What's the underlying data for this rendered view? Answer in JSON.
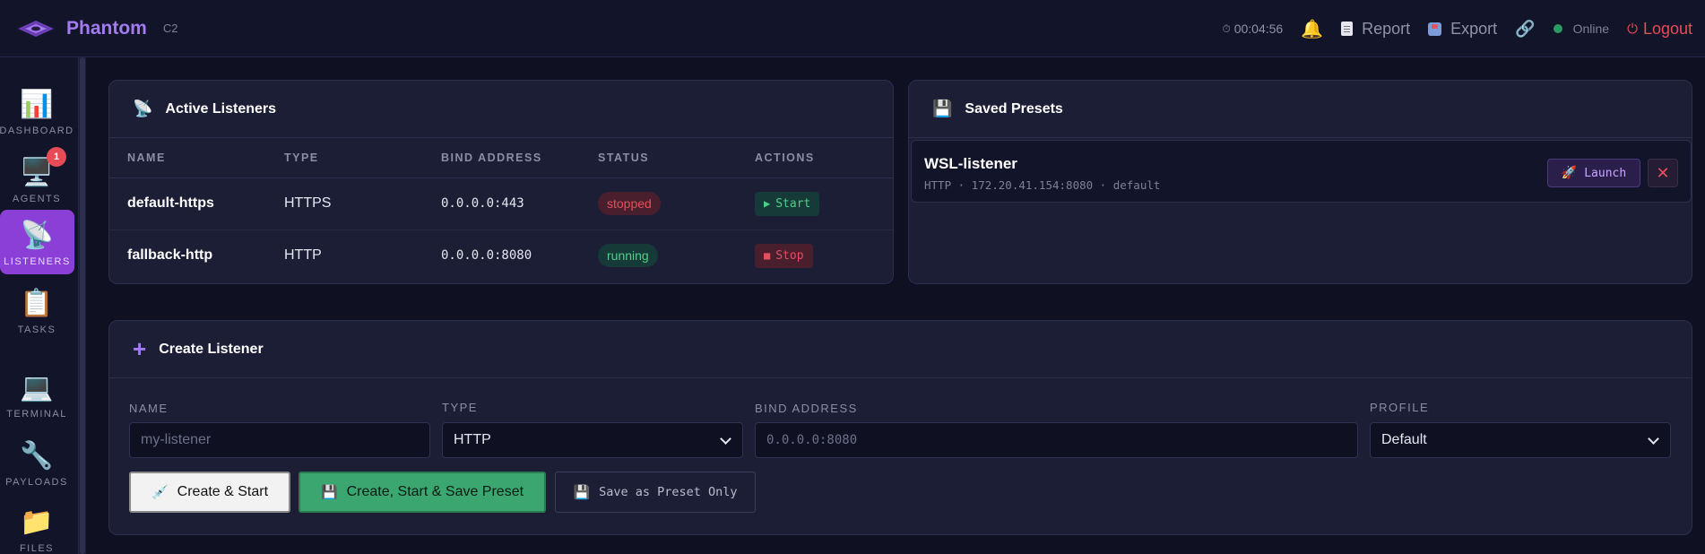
{
  "app": {
    "name": "Phantom",
    "tag": "C2"
  },
  "topbar": {
    "timer": "00:04:56",
    "report_label": "Report",
    "export_label": "Export",
    "status_label": "Online",
    "logout_label": "Logout"
  },
  "sidebar": {
    "items": [
      {
        "label": "DASHBOARD",
        "icon": "📊"
      },
      {
        "label": "AGENTS",
        "icon": "🖥️",
        "badge": "1"
      },
      {
        "label": "LISTENERS",
        "icon": "📡"
      },
      {
        "label": "TASKS",
        "icon": "📋"
      },
      {
        "label": "TERMINAL",
        "icon": "💻"
      },
      {
        "label": "PAYLOADS",
        "icon": "🔧"
      },
      {
        "label": "FILES",
        "icon": "📁"
      }
    ]
  },
  "listeners": {
    "title": "Active Listeners",
    "columns": [
      "NAME",
      "TYPE",
      "BIND ADDRESS",
      "STATUS",
      "ACTIONS"
    ],
    "rows": [
      {
        "name": "default-https",
        "type": "HTTPS",
        "bind": "0.0.0.0:443",
        "status": "stopped",
        "action": "Start"
      },
      {
        "name": "fallback-http",
        "type": "HTTP",
        "bind": "0.0.0.0:8080",
        "status": "running",
        "action": "Stop"
      }
    ]
  },
  "presets": {
    "title": "Saved Presets",
    "items": [
      {
        "name": "WSL-listener",
        "meta": "HTTP · 172.20.41.154:8080 · default",
        "launch_label": "Launch",
        "remove_label": "✕"
      }
    ]
  },
  "create": {
    "title": "Create Listener",
    "name_label": "NAME",
    "name_placeholder": "my-listener",
    "type_label": "TYPE",
    "type_value": "HTTP",
    "bind_label": "BIND ADDRESS",
    "bind_placeholder": "0.0.0.0:8080",
    "profile_label": "PROFILE",
    "profile_value": "Default",
    "btn_create_start": "Create & Start",
    "btn_create_start_save": "Create, Start & Save Preset",
    "btn_save_only": "Save as Preset Only"
  },
  "colors": {
    "accent": "#8b3fd6",
    "brand": "#a27bf0",
    "danger": "#e64c55",
    "success": "#3ba670"
  }
}
